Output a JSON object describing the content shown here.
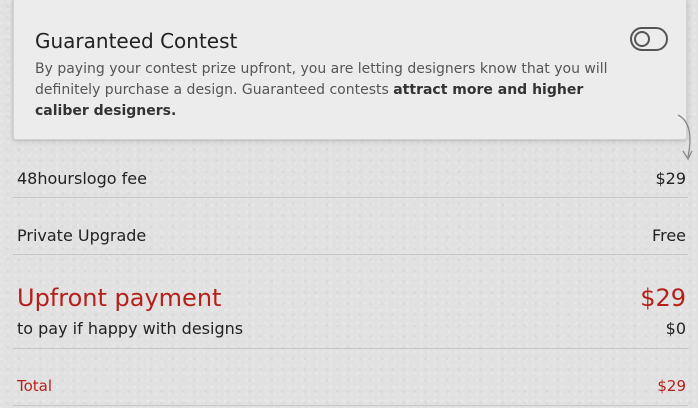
{
  "guaranteed": {
    "title": "Guaranteed Contest",
    "description_plain": "By paying your contest prize upfront, you are letting designers know that you will definitely purchase a design. Guaranteed contests ",
    "description_bold": "attract more and higher caliber designers.",
    "toggle_on": false
  },
  "summary": {
    "fee": {
      "label": "48hourslogo fee",
      "value": "$29"
    },
    "private_upgrade": {
      "label": "Private Upgrade",
      "value": "Free"
    },
    "upfront": {
      "label": "Upfront payment",
      "value": "$29",
      "sublabel": "to pay if happy with designs",
      "subvalue": "$0"
    },
    "total": {
      "label": "Total",
      "value": "$29"
    }
  },
  "colors": {
    "accent_red": "#b5201b",
    "background": "#e1e1e1",
    "card": "#ececec"
  }
}
